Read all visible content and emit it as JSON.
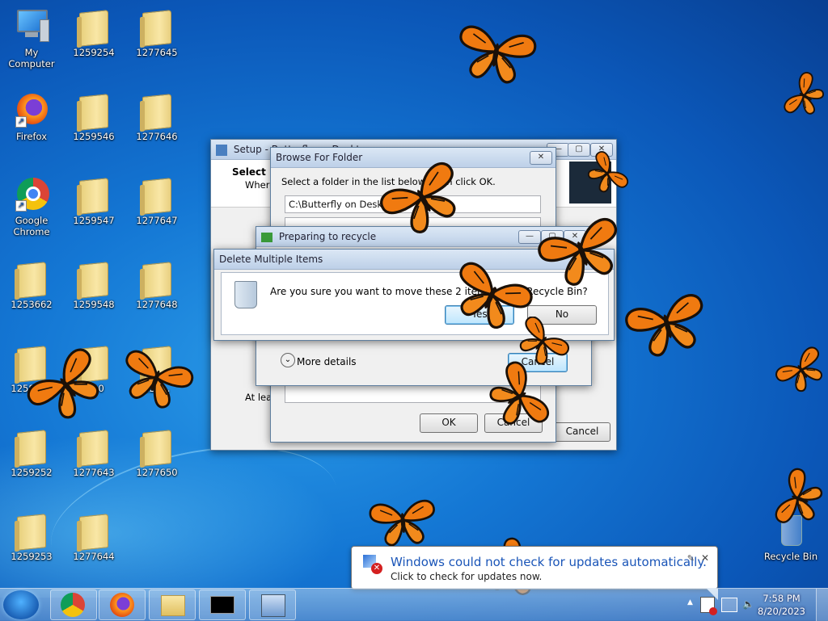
{
  "desktop": {
    "icons": [
      {
        "label": "My Computer",
        "type": "computer"
      },
      {
        "label": "1259254",
        "type": "folder"
      },
      {
        "label": "1277645",
        "type": "folder"
      },
      {
        "label": "Firefox",
        "type": "firefox"
      },
      {
        "label": "1259546",
        "type": "folder"
      },
      {
        "label": "1277646",
        "type": "folder"
      },
      {
        "label": "Google Chrome",
        "type": "chrome"
      },
      {
        "label": "1259547",
        "type": "folder"
      },
      {
        "label": "1277647",
        "type": "folder"
      },
      {
        "label": "1253662",
        "type": "folder"
      },
      {
        "label": "1259548",
        "type": "folder"
      },
      {
        "label": "1277648",
        "type": "folder"
      },
      {
        "label": "1258113",
        "type": "folder"
      },
      {
        "label": "...10",
        "type": "folder"
      },
      {
        "label": "127...",
        "type": "folder"
      },
      {
        "label": "1259252",
        "type": "folder"
      },
      {
        "label": "1277643",
        "type": "folder"
      },
      {
        "label": "1277650",
        "type": "folder"
      },
      {
        "label": "1259253",
        "type": "folder"
      },
      {
        "label": "1277644",
        "type": "folder"
      }
    ],
    "recycle_bin": "Recycle Bin"
  },
  "setup_window": {
    "title": "Setup - Butterfly on Desktop",
    "heading": "Select D",
    "subheading": "Where",
    "footer_text": "At leas",
    "cancel": "Cancel"
  },
  "browse_dialog": {
    "title": "Browse For Folder",
    "instruction": "Select a folder in the list below, then click OK.",
    "path": "C:\\Butterfly on Desktop",
    "ok": "OK",
    "cancel": "Cancel"
  },
  "preparing_dialog": {
    "title": "Preparing to recycle",
    "more_details": "More details",
    "cancel": "Cancel"
  },
  "delete_dialog": {
    "title": "Delete Multiple Items",
    "question": "Are you sure you want to move these 2 items to the Recycle Bin?",
    "yes": "Yes",
    "no": "No"
  },
  "notification": {
    "title": "Windows could not check for updates automatically.",
    "message": "Click to check for updates now."
  },
  "taskbar": {
    "time": "7:58 PM",
    "date": "8/20/2023",
    "tray_arrow": "▲"
  },
  "colors": {
    "desktop_blue": "#1477d4",
    "butterfly_orange": "#f07a10",
    "link_blue": "#1a55b8"
  }
}
